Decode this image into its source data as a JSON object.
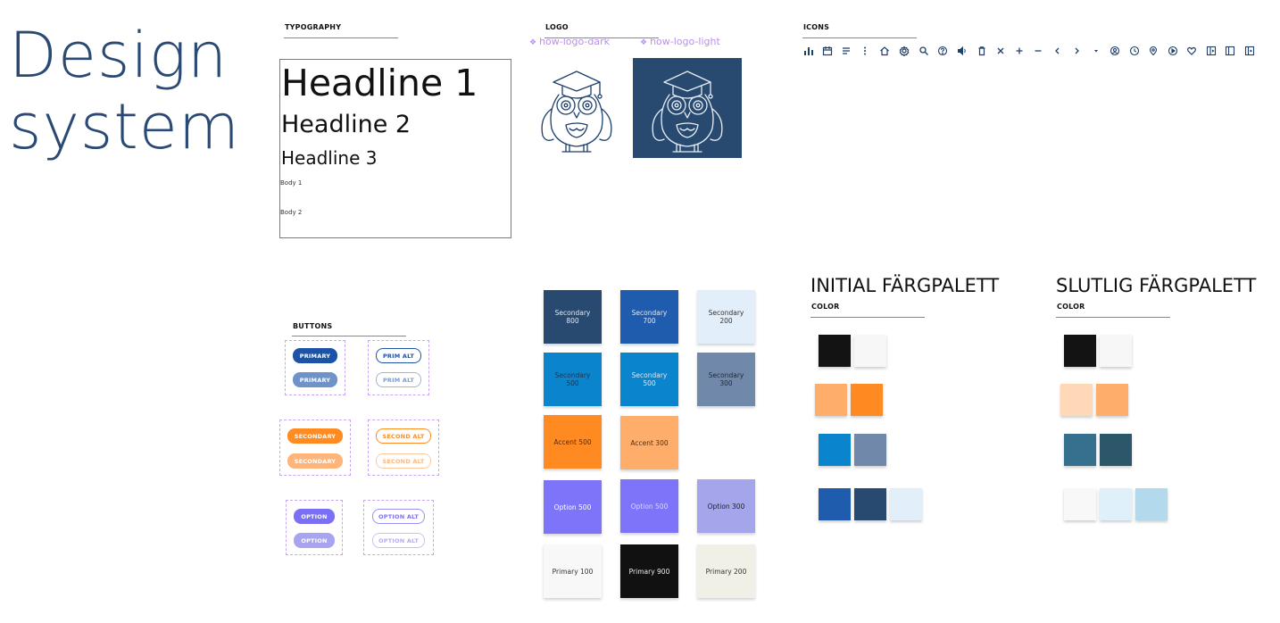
{
  "title": {
    "line1": "Design",
    "line2": "system"
  },
  "typography": {
    "header": "TYPOGRAPHY",
    "h1": "Headline 1",
    "h2": "Headline 2",
    "h3": "Headline 3",
    "body1": "Body 1",
    "body2": "Body 2"
  },
  "logo": {
    "header": "LOGO",
    "dark_label": "how-logo-dark",
    "light_label": "how-logo-light",
    "component_glyph": "❖",
    "dark_bg": "#284a70"
  },
  "icons": {
    "header": "ICONS",
    "items": [
      "bar-chart-icon",
      "calendar-icon",
      "list-icon",
      "more-vert-icon",
      "home-icon",
      "settings-icon",
      "search-icon",
      "help-icon",
      "volume-icon",
      "trash-icon",
      "close-icon",
      "plus-icon",
      "minus-icon",
      "chevron-left-icon",
      "chevron-right-icon",
      "caret-down-icon",
      "account-icon",
      "clock-icon",
      "location-icon",
      "play-icon",
      "heart-icon",
      "panel-icon",
      "sidebar-icon",
      "exit-icon"
    ]
  },
  "buttons": {
    "header": "BUTTONS",
    "primary": "PRIMARY",
    "prim_alt": "PRIM ALT",
    "secondary": "SECONDARY",
    "second_alt": "SECOND ALT",
    "option": "OPTION",
    "option_alt": "OPTION ALT"
  },
  "swatches": [
    {
      "label": "Secondary\n800",
      "color": "#284a70",
      "text": "#dfe7f3"
    },
    {
      "label": "Secondary\n700",
      "color": "#1f5cad",
      "text": "#dfe7f3"
    },
    {
      "label": "Secondary\n200",
      "color": "#e3eefb",
      "text": "#333"
    },
    {
      "label": "Secondary\n500",
      "color": "#0a84cc",
      "text": "#1d3550"
    },
    {
      "label": "Secondary\n500",
      "color": "#0a84cc",
      "text": "#dfe7f3"
    },
    {
      "label": "Secondary\n300",
      "color": "#7089aa",
      "text": "#1d2a3a"
    },
    {
      "label": "Accent 500",
      "color": "#ff8a22",
      "text": "#5a2e05"
    },
    {
      "label": "Accent 300",
      "color": "#ffad6b",
      "text": "#5a2e05"
    },
    {
      "label": "Option 500",
      "color": "#7d74fa",
      "text": "#fff"
    },
    {
      "label": "Option 500",
      "color": "#7d74fa",
      "text": "#dcd8ff"
    },
    {
      "label": "Option 300",
      "color": "#a5a5ec",
      "text": "#222"
    },
    {
      "label": "Primary 100",
      "color": "#f8f8f8",
      "text": "#333"
    },
    {
      "label": "Primary 900",
      "color": "#111111",
      "text": "#eee"
    },
    {
      "label": "Primary 200",
      "color": "#f0f0e6",
      "text": "#333"
    }
  ],
  "initial_palette": {
    "title": "INITIAL FÄRGPALETT",
    "header": "COLOR",
    "rows": [
      [
        "#131313",
        "#f7f7f7"
      ],
      [
        "#ffad6b",
        "#ff8a22"
      ],
      [
        "#0a84cc",
        "#7089aa"
      ],
      [
        "#1f5cad",
        "#284a70",
        "#e3eefb"
      ]
    ]
  },
  "final_palette": {
    "title": "SLUTLIG FÄRGPALETT",
    "header": "COLOR",
    "rows": [
      [
        "#131313",
        "#f7f7f7"
      ],
      [
        "#ffd9b7",
        "#ffad6b"
      ],
      [
        "#35708f",
        "#2c5669"
      ],
      [
        "#f8f8f8",
        "#dff0fb",
        "#b2d9ec"
      ]
    ]
  }
}
